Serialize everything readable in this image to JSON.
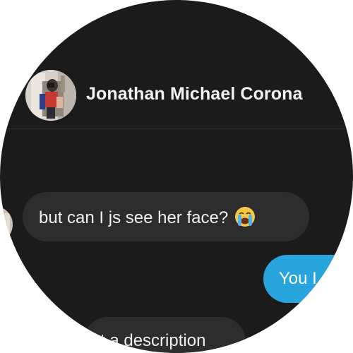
{
  "header": {
    "contact_name": "Jonathan Michael Corona",
    "avatar_icon": "profile-photo-icon"
  },
  "messages": [
    {
      "direction": "incoming",
      "text": "but can I js see her face?",
      "emoji": "loudly-crying-face-icon"
    },
    {
      "direction": "outgoing",
      "text": "You I"
    },
    {
      "direction": "incoming",
      "text": "t a description"
    }
  ],
  "colors": {
    "background": "#1b1b1b",
    "incoming_bubble": "#2d2d2d",
    "outgoing_bubble": "#27a5dc",
    "text": "#f0f0f0"
  }
}
